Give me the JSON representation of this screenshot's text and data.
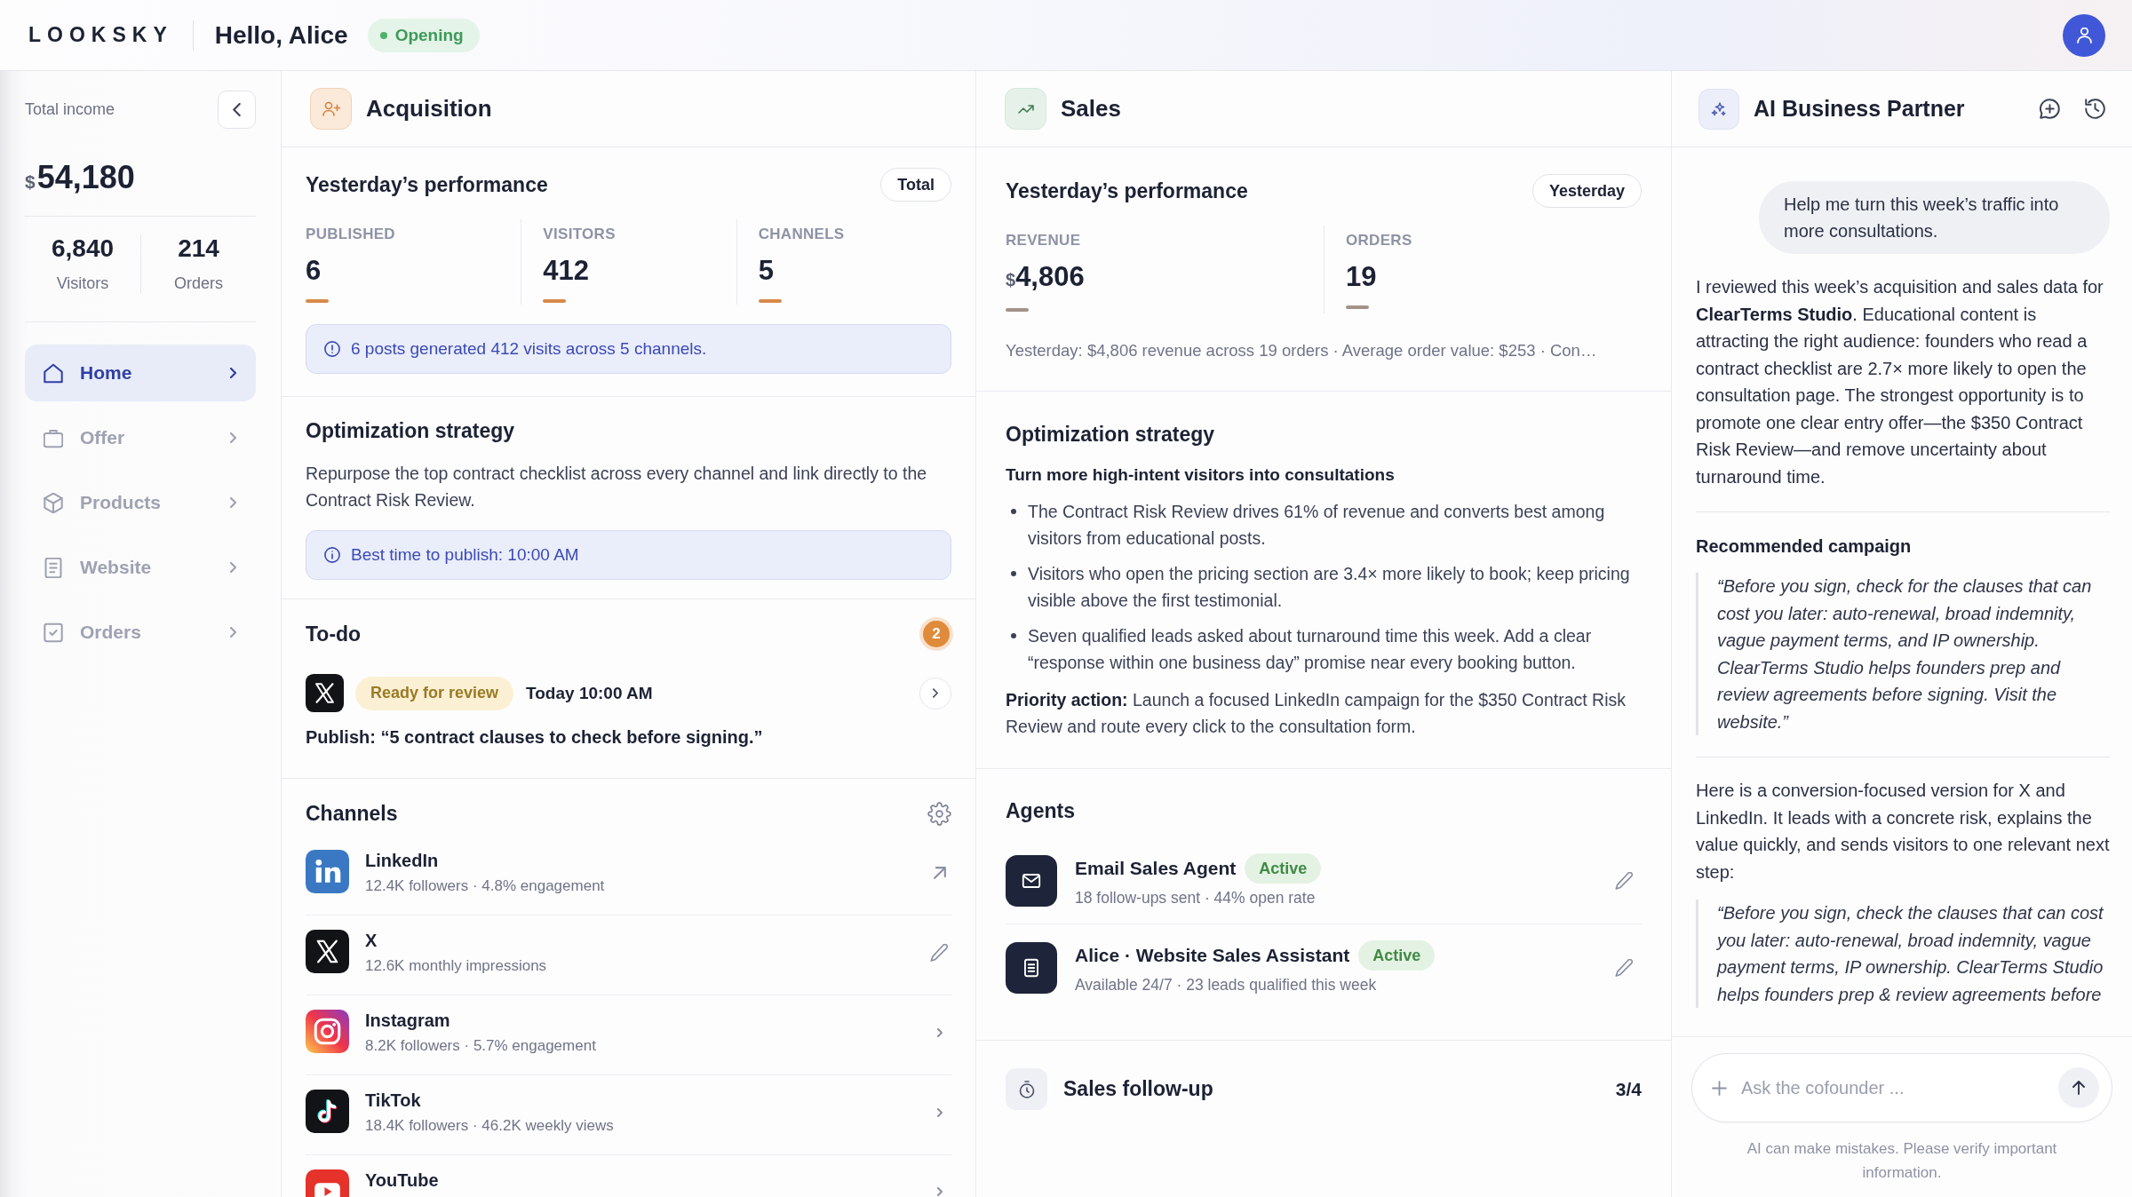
{
  "top_bar": {
    "logo": "LOOKSKY",
    "greeting": "Hello, Alice",
    "status": "Opening"
  },
  "sidebar": {
    "total_income": {
      "label": "Total income",
      "currency": "$",
      "value": "54,180"
    },
    "stats": [
      {
        "value": "6,840",
        "label": "Visitors"
      },
      {
        "value": "214",
        "label": "Orders"
      }
    ],
    "nav": [
      {
        "label": "Home",
        "selected": true
      },
      {
        "label": "Offer",
        "selected": false
      },
      {
        "label": "Products",
        "selected": false
      },
      {
        "label": "Website",
        "selected": false
      },
      {
        "label": "Orders",
        "selected": false
      }
    ]
  },
  "acquisition": {
    "title": "Acquisition",
    "performance": {
      "title": "Yesterday’s performance",
      "period_button": "Total",
      "stats": [
        {
          "label": "PUBLISHED",
          "value": "6"
        },
        {
          "label": "VISITORS",
          "value": "412"
        },
        {
          "label": "CHANNELS",
          "value": "5"
        }
      ],
      "note": "6 posts generated 412 visits across 5 channels."
    },
    "strategy": {
      "title": "Optimization strategy",
      "text": "Repurpose the top contract checklist across every channel and link directly to the Contract Risk Review.",
      "note": "Best time to publish: 10:00 AM"
    },
    "todo": {
      "title": "To-do",
      "count": "2",
      "items": [
        {
          "status": "Ready for review",
          "time": "Today 10:00 AM",
          "text": "Publish: “5 contract clauses to check before signing.”"
        }
      ]
    },
    "channels": {
      "title": "Channels",
      "items": [
        {
          "name": "LinkedIn",
          "detail": "12.4K followers · 4.8% engagement",
          "kind": "link"
        },
        {
          "name": "X",
          "detail": "12.6K monthly impressions",
          "kind": "edit"
        },
        {
          "name": "Instagram",
          "detail": "8.2K followers · 5.7% engagement",
          "kind": "nav"
        },
        {
          "name": "TikTok",
          "detail": "18.4K followers · 46.2K weekly views",
          "kind": "nav"
        },
        {
          "name": "YouTube",
          "kind": "nav"
        }
      ]
    }
  },
  "sales": {
    "title": "Sales",
    "performance": {
      "title": "Yesterday’s performance",
      "period_button": "Yesterday",
      "stats": [
        {
          "label": "REVENUE",
          "currency": "$",
          "value": "4,806"
        },
        {
          "label": "ORDERS",
          "value": "19"
        }
      ],
      "summary": "Yesterday: $4,806 revenue across 19 orders · Average order value: $253 · Con…"
    },
    "strategy": {
      "title": "Optimization strategy",
      "subtitle": "Turn more high-intent visitors into consultations",
      "bullets": [
        "The Contract Risk Review drives 61% of revenue and converts best among visitors from educational posts.",
        "Visitors who open the pricing section are 3.4× more likely to book; keep pricing visible above the first testimonial.",
        "Seven qualified leads asked about turnaround time this week. Add a clear “response within one business day” promise near every booking button."
      ],
      "priority": "**Priority action:** Launch a focused LinkedIn campaign for the $350 Contract Risk Review and route every click to the consultation form."
    },
    "agents": {
      "title": "Agents",
      "items": [
        {
          "name": "Email Sales Agent",
          "status": "Active",
          "detail": "18 follow-ups sent · 44% open rate"
        },
        {
          "name": "Alice · Website Sales Assistant",
          "status": "Active",
          "detail": "Available 24/7 · 23 leads qualified this week"
        }
      ]
    },
    "follow_up": {
      "title": "Sales follow-up",
      "count": "3/4"
    }
  },
  "assistant": {
    "title": "AI Business Partner",
    "user_message": "Help me turn this week’s traffic into more consultations.",
    "reply": [
      {
        "kind": "paragraph",
        "text": "I reviewed this week’s acquisition and sales data for **ClearTerms Studio**. Educational content is attracting the right audience: founders who read a contract checklist are 2.7× more likely to open the consultation page. The strongest opportunity is to promote one clear entry offer—the $350 Contract Risk Review—and remove uncertainty about turnaround time."
      },
      {
        "kind": "divider"
      },
      {
        "kind": "heading",
        "text": "Recommended campaign"
      },
      {
        "kind": "quote",
        "text": "“Before you sign, check for the clauses that can cost you later: auto-renewal, broad indemnity, vague payment terms, and IP ownership. ClearTerms Studio helps founders prep and review agreements before signing. Visit the website.”"
      },
      {
        "kind": "divider"
      },
      {
        "kind": "paragraph",
        "text": "Here is a conversion-focused version for X and LinkedIn. It leads with a concrete risk, explains the value quickly, and sends visitors to one relevant next step:"
      },
      {
        "kind": "quote",
        "text": "“Before you sign, check the clauses that can cost you later: auto-renewal, broad indemnity, vague payment terms, IP ownership. ClearTerms Studio helps founders prep & review agreements before"
      }
    ],
    "input": {
      "placeholder": "Ask the cofounder ..."
    },
    "disclaimer": "AI can make mistakes. Please verify important information."
  }
}
